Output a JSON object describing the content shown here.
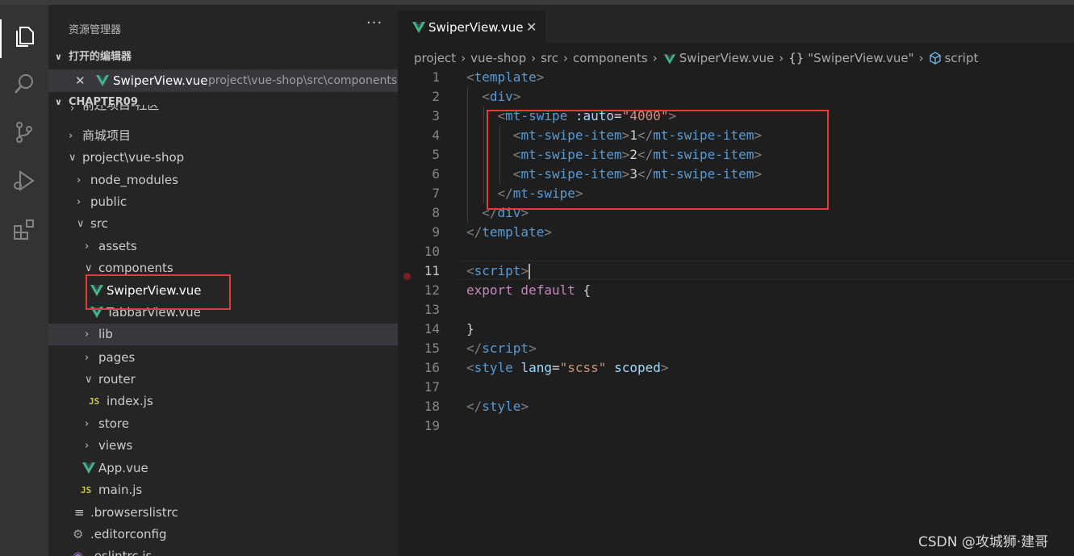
{
  "explorer": {
    "title": "资源管理器",
    "more": "···",
    "open_editors": {
      "header": "打开的编辑器",
      "items": [
        {
          "name": "SwiperView.vue",
          "path": "project\\vue-shop\\src\\components"
        }
      ]
    },
    "workspace_header": "CHAPTER09",
    "tree": [
      {
        "label": "前还项目-社区"
      },
      {
        "label": "商城项目"
      },
      {
        "label": "project\\vue-shop"
      },
      {
        "label": "node_modules"
      },
      {
        "label": "public"
      },
      {
        "label": "src"
      },
      {
        "label": "assets"
      },
      {
        "label": "components"
      },
      {
        "label": "SwiperView.vue"
      },
      {
        "label": "TabbarView.vue"
      },
      {
        "label": "lib"
      },
      {
        "label": "pages"
      },
      {
        "label": "router"
      },
      {
        "label": "index.js"
      },
      {
        "label": "store"
      },
      {
        "label": "views"
      },
      {
        "label": "App.vue"
      },
      {
        "label": "main.js"
      },
      {
        "label": ".browserslistrc"
      },
      {
        "label": ".editorconfig"
      },
      {
        "label": ".eslintrc.js"
      }
    ]
  },
  "editor": {
    "tab": {
      "label": "SwiperView.vue",
      "close": "✕"
    },
    "breadcrumb": [
      "project",
      "vue-shop",
      "src",
      "components",
      "SwiperView.vue",
      "\"SwiperView.vue\"",
      "script"
    ],
    "breadcrumb_braces": "{}",
    "line_numbers": [
      "1",
      "2",
      "3",
      "4",
      "5",
      "6",
      "7",
      "8",
      "9",
      "10",
      "11",
      "12",
      "13",
      "14",
      "15",
      "16",
      "17",
      "18",
      "19"
    ],
    "code": {
      "l1": "template",
      "l2": "div",
      "l3_tag": "mt-swipe",
      "l3_attr": ":auto",
      "l3_val": "\"4000\"",
      "item_tag": "mt-swipe-item",
      "item_values": [
        "1",
        "2",
        "3"
      ],
      "l7": "mt-swipe",
      "l8": "div",
      "l10": "template",
      "l11": "script",
      "l12_kw": "export default",
      "l12_brace": "{",
      "l14": "}",
      "l15": "script",
      "l16_tag": "style",
      "l16_attr": "lang",
      "l16_val": "\"scss\"",
      "l16_attr2": "scoped",
      "l18": "style"
    }
  },
  "watermark": "CSDN @攻城狮·建哥",
  "colors": {
    "vue": "#41b883",
    "highlight": "#e33a3a",
    "js": "#cbcb41"
  }
}
